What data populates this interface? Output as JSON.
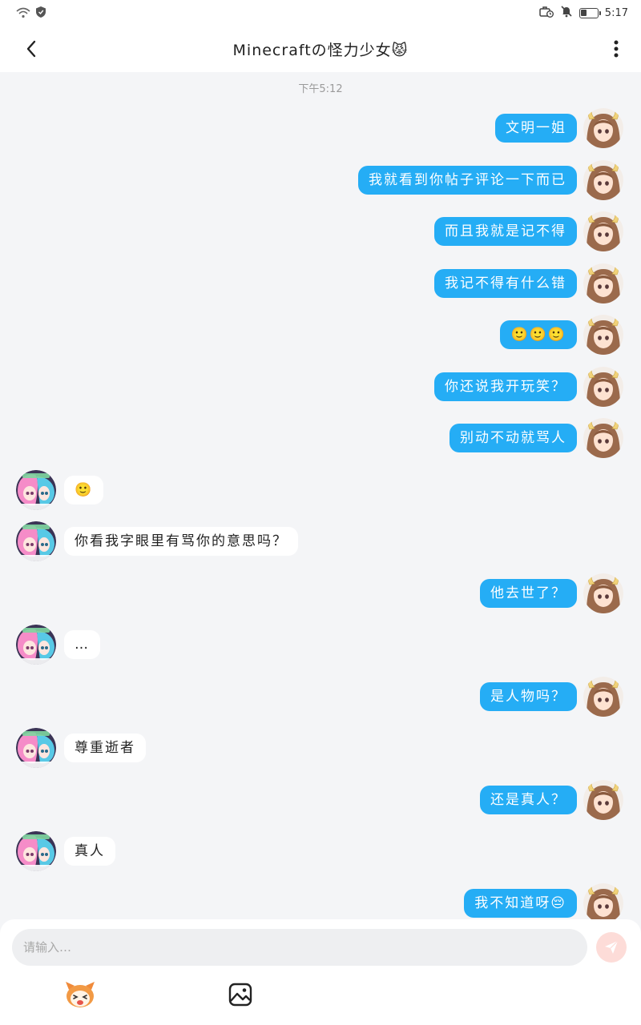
{
  "status_bar": {
    "time": "5:17",
    "battery_level": 0.35,
    "icons": [
      "wifi-icon",
      "shield-icon",
      "briefcase-clock-icon",
      "bell-muted-icon",
      "battery-icon"
    ]
  },
  "header": {
    "title": "Minecraftの怪力少女😾",
    "back_icon": "chevron-left-icon",
    "more_icon": "vertical-dots-icon"
  },
  "chat": {
    "timestamp": "下午5:12",
    "messages": [
      {
        "side": "right",
        "text": "文明一姐"
      },
      {
        "side": "right",
        "text": "我就看到你帖子评论一下而已"
      },
      {
        "side": "right",
        "text": "而且我就是记不得"
      },
      {
        "side": "right",
        "text": "我记不得有什么错"
      },
      {
        "side": "right",
        "text": "🙂🙂🙂"
      },
      {
        "side": "right",
        "text": "你还说我开玩笑？"
      },
      {
        "side": "right",
        "text": "别动不动就骂人"
      },
      {
        "side": "left",
        "text": "🙂"
      },
      {
        "side": "left",
        "text": "你看我字眼里有骂你的意思吗？"
      },
      {
        "side": "right",
        "text": "他去世了？"
      },
      {
        "side": "left",
        "text": "…"
      },
      {
        "side": "right",
        "text": "是人物吗？"
      },
      {
        "side": "left",
        "text": "尊重逝者"
      },
      {
        "side": "right",
        "text": "还是真人？"
      },
      {
        "side": "left",
        "text": "真人"
      },
      {
        "side": "right",
        "text": "我不知道呀😔"
      }
    ]
  },
  "input": {
    "placeholder": "请输入…",
    "value": ""
  },
  "toolbar": {
    "items": [
      "mascot-emoji-icon",
      "image-icon"
    ]
  },
  "colors": {
    "my_bubble": "#25adf5",
    "their_bubble": "#ffffff",
    "background": "#f4f5f7",
    "send_button": "#fddcd8"
  }
}
